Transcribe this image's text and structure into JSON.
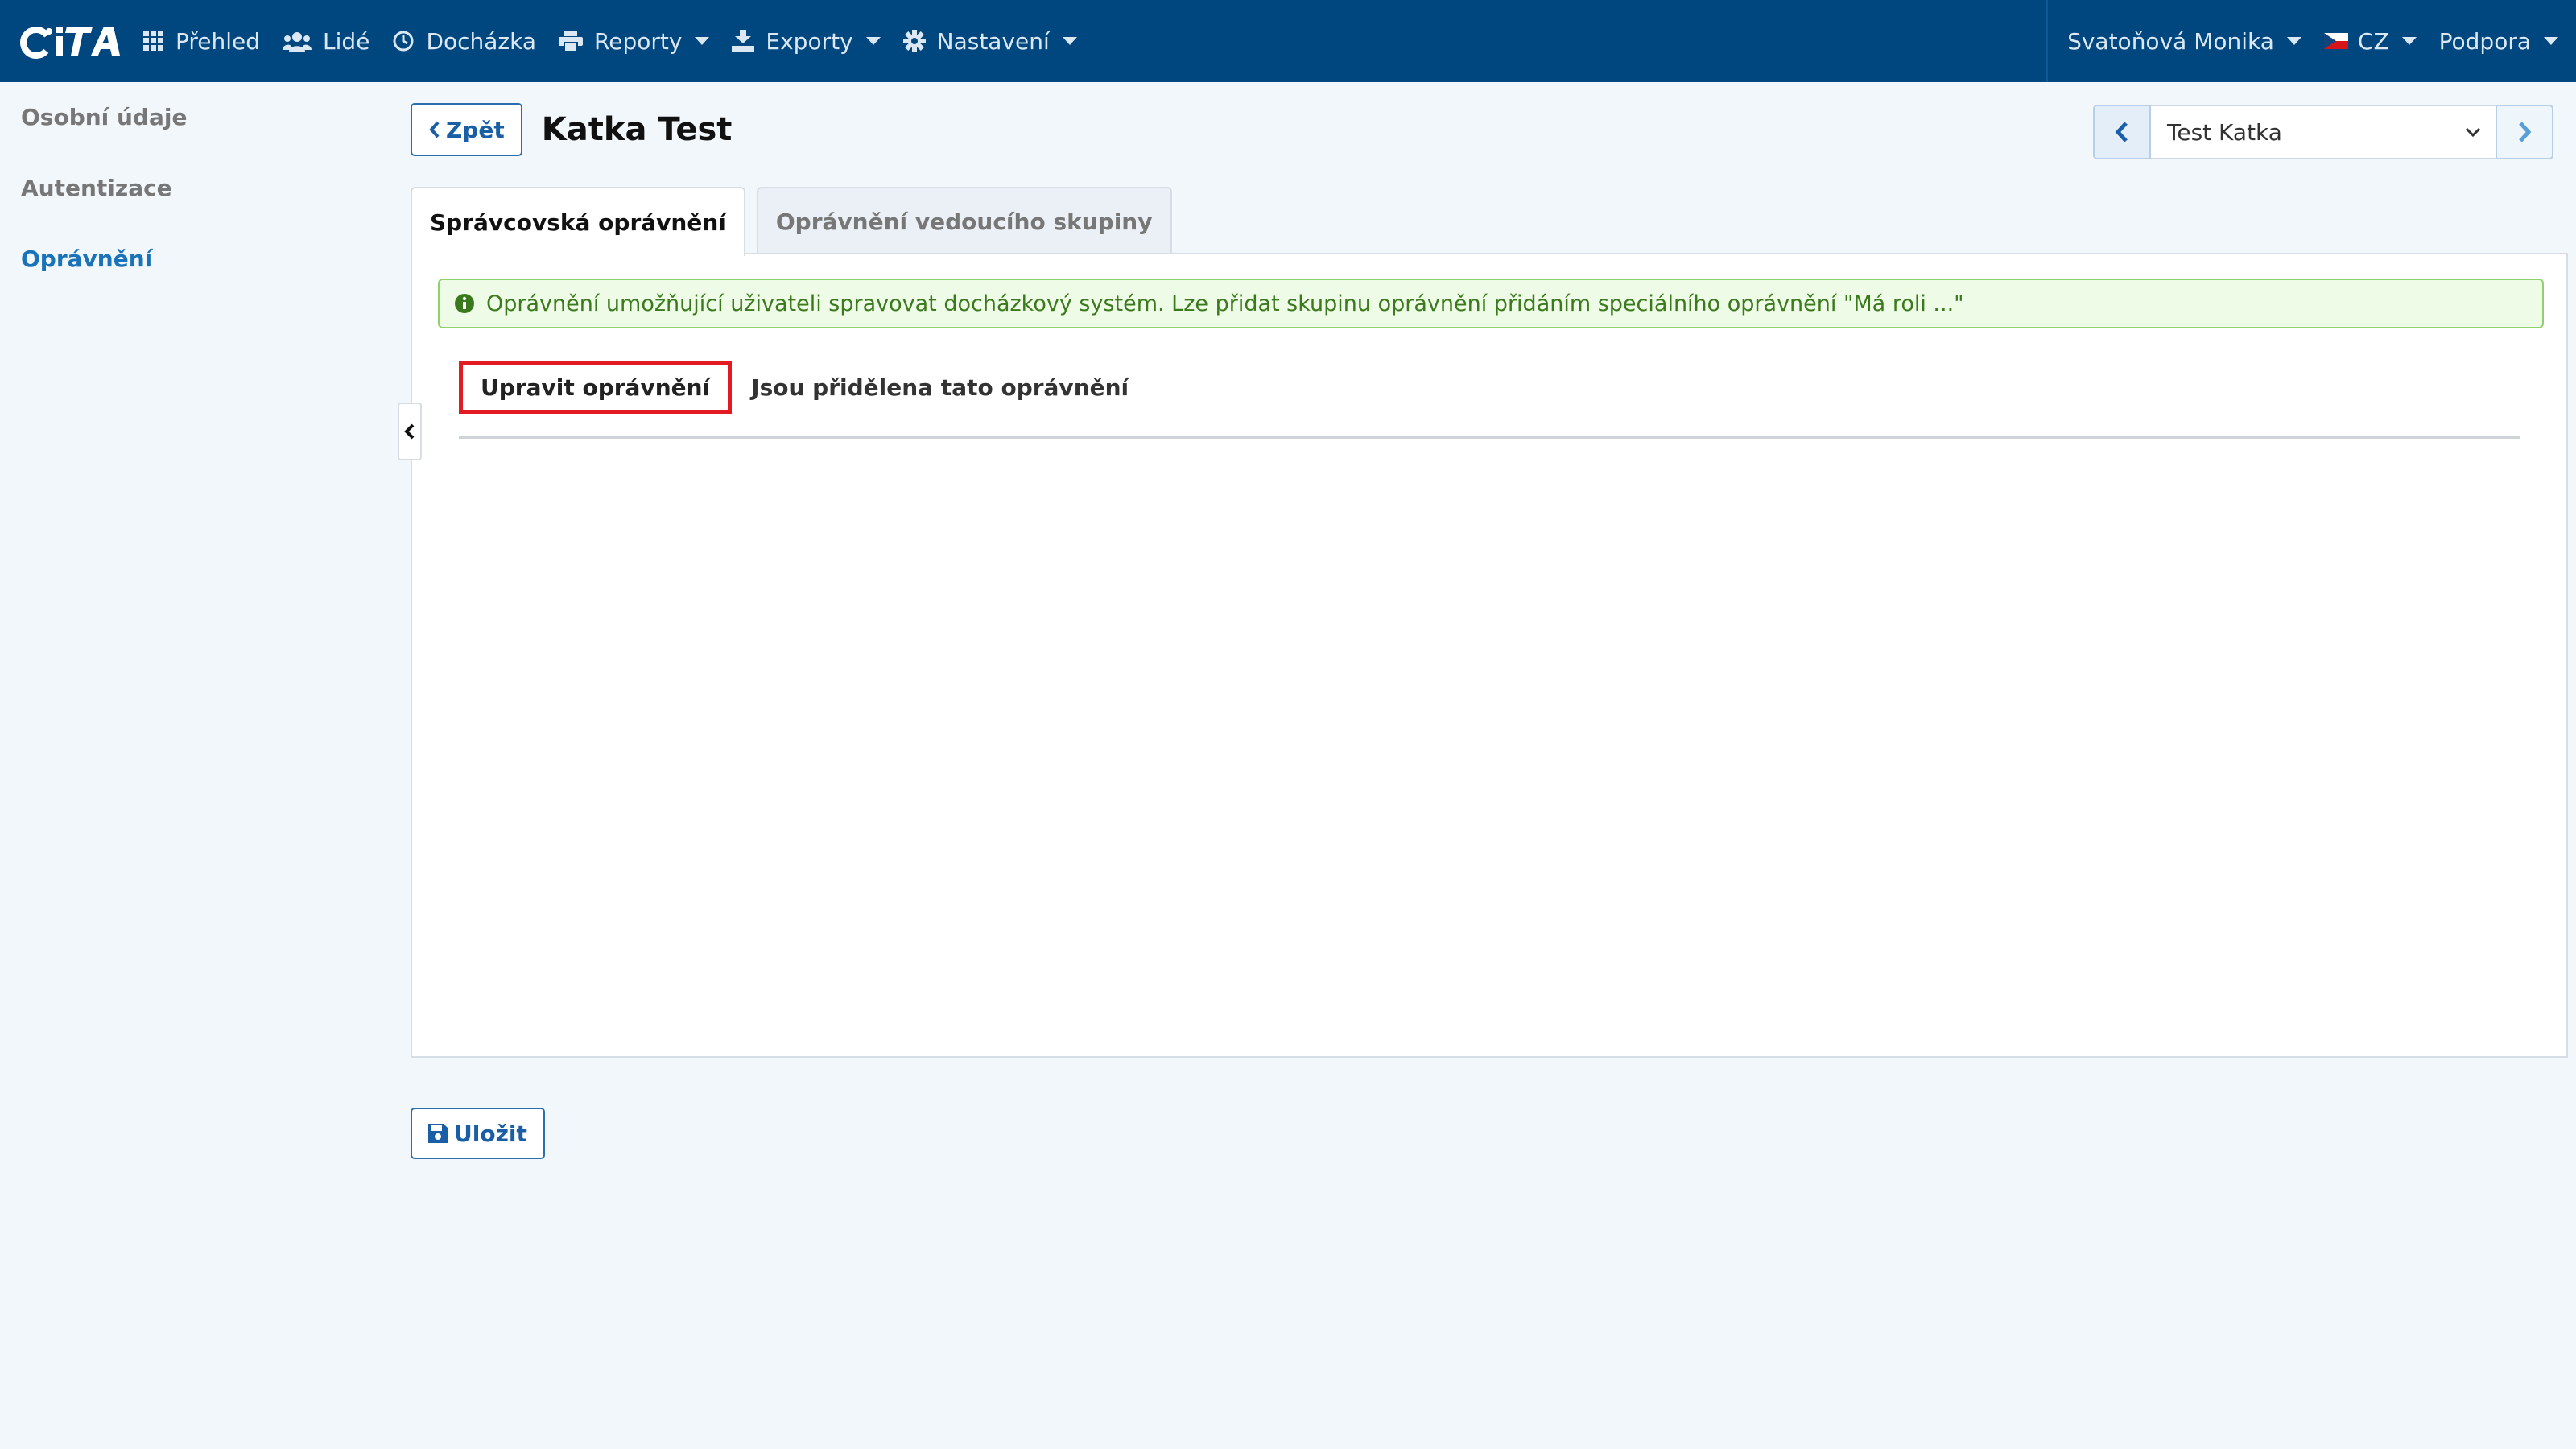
{
  "navbar": {
    "logo_text": "CITA",
    "items": [
      {
        "label": "Přehled",
        "icon": "grid-icon",
        "dropdown": false
      },
      {
        "label": "Lidé",
        "icon": "users-icon",
        "dropdown": false
      },
      {
        "label": "Docházka",
        "icon": "clock-icon",
        "dropdown": false
      },
      {
        "label": "Reporty",
        "icon": "printer-icon",
        "dropdown": true
      },
      {
        "label": "Exporty",
        "icon": "export-icon",
        "dropdown": true
      },
      {
        "label": "Nastavení",
        "icon": "gear-icon",
        "dropdown": true
      }
    ],
    "user": "Svatoňová Monika",
    "language": "CZ",
    "support": "Podpora"
  },
  "sidebar": {
    "items": [
      {
        "label": "Osobní údaje",
        "active": false
      },
      {
        "label": "Autentizace",
        "active": false
      },
      {
        "label": "Oprávnění",
        "active": true
      }
    ]
  },
  "header": {
    "back_label": "Zpět",
    "title": "Katka Test",
    "user_select": "Test Katka"
  },
  "tabs": [
    {
      "label": "Správcovská oprávnění",
      "active": true
    },
    {
      "label": "Oprávnění vedoucího skupiny",
      "active": false
    }
  ],
  "alert": {
    "text": "Oprávnění umožňující uživateli spravovat docházkový systém. Lze přidat skupinu oprávnění přidáním speciálního oprávnění \"Má roli ...\""
  },
  "subtabs": [
    {
      "label": "Upravit oprávnění",
      "highlighted": true
    },
    {
      "label": "Jsou přidělena tato oprávnění",
      "highlighted": false
    }
  ],
  "footer": {
    "save_label": "Uložit"
  },
  "colors": {
    "navbar": "#00467f",
    "accent": "#1a73b8",
    "highlight": "#e21b23",
    "alert_bg": "#eefbe6",
    "alert_text": "#3a7a1c"
  }
}
